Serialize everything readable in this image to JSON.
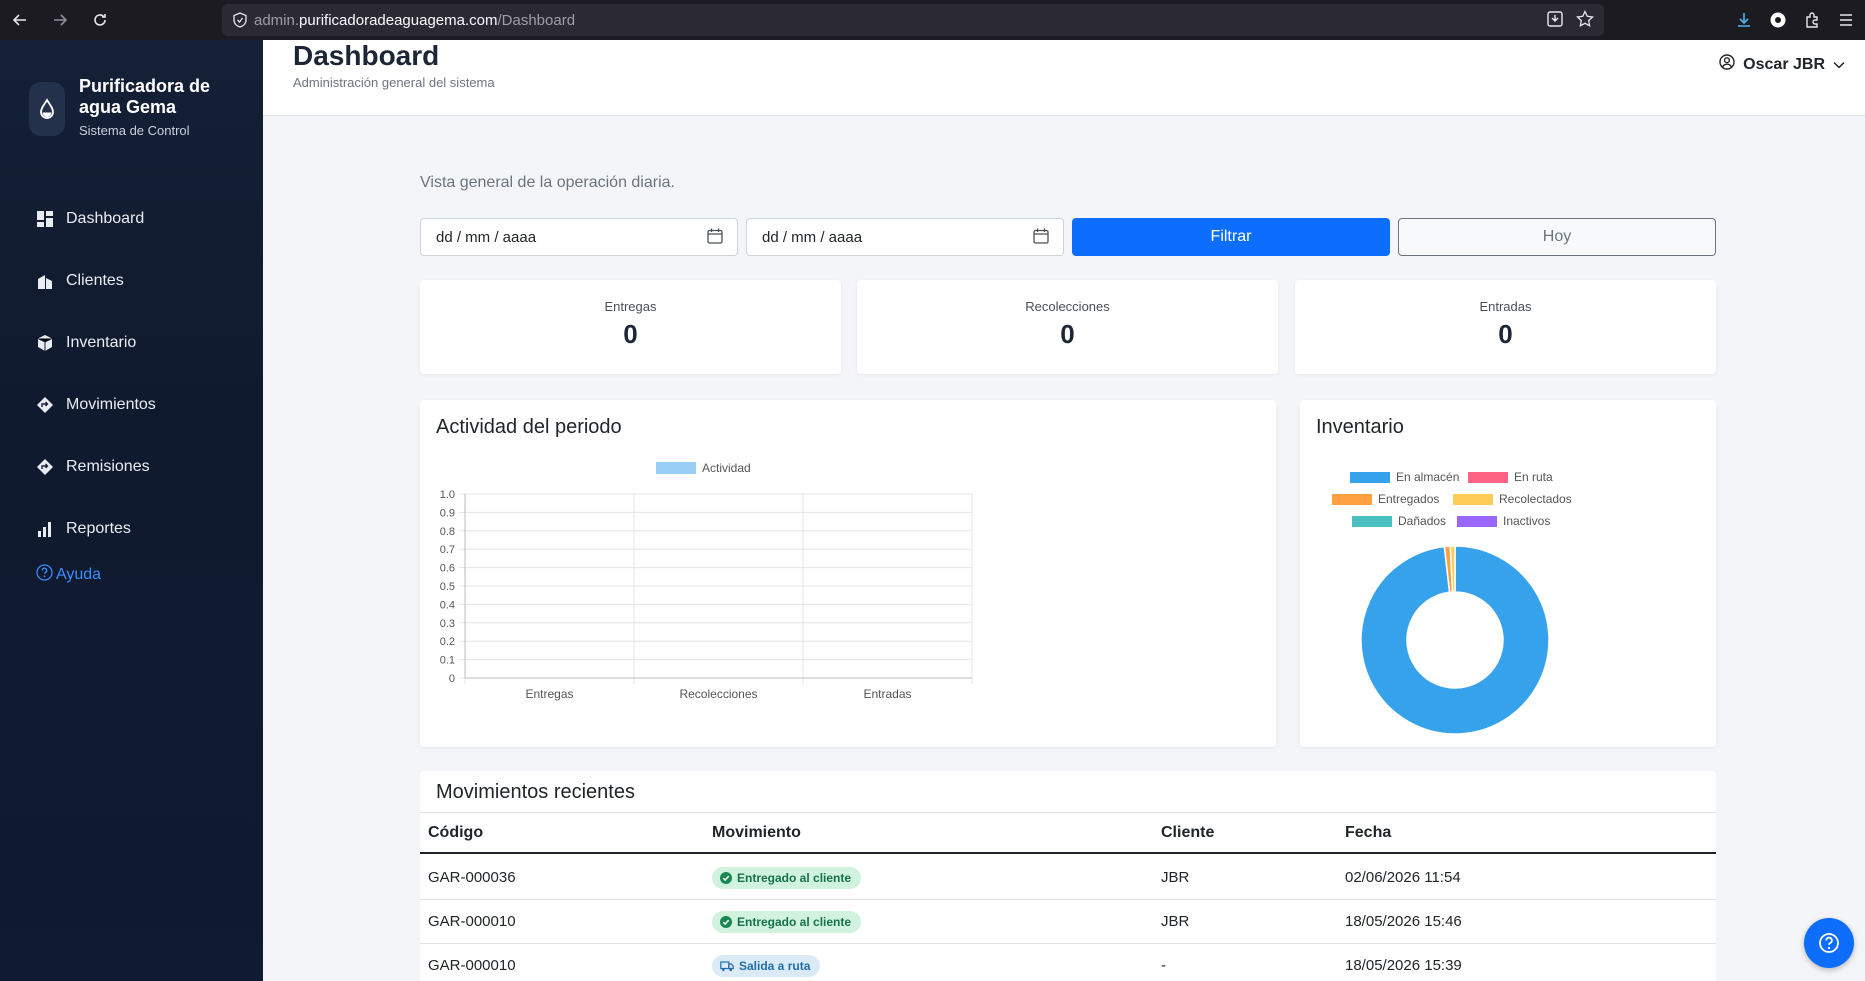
{
  "browser": {
    "url_prefix": "admin.",
    "url_host": "purificadoradeaguagema.com",
    "url_path": "/Dashboard"
  },
  "sidebar": {
    "brand_name": "Purificadora de agua Gema",
    "brand_sub": "Sistema de Control",
    "items": [
      {
        "label": "Dashboard",
        "icon": "dashboard-icon"
      },
      {
        "label": "Clientes",
        "icon": "building-icon"
      },
      {
        "label": "Inventario",
        "icon": "box-icon"
      },
      {
        "label": "Movimientos",
        "icon": "diamond-arrow-icon"
      },
      {
        "label": "Remisiones",
        "icon": "diamond-arrow-icon"
      },
      {
        "label": "Reportes",
        "icon": "bar-chart-icon"
      }
    ],
    "help_label": "Ayuda"
  },
  "header": {
    "title": "Dashboard",
    "subtitle": "Administración general del sistema",
    "user": "Oscar JBR"
  },
  "main": {
    "intro": "Vista general de la operación diaria.",
    "date_from_placeholder": "dd / mm / aaaa",
    "date_to_placeholder": "dd / mm / aaaa",
    "filter_label": "Filtrar",
    "today_label": "Hoy",
    "stats": [
      {
        "label": "Entregas",
        "value": "0"
      },
      {
        "label": "Recolecciones",
        "value": "0"
      },
      {
        "label": "Entradas",
        "value": "0"
      }
    ],
    "activity_title": "Actividad del periodo",
    "inventory_title": "Inventario",
    "recent_title": "Movimientos recientes"
  },
  "chart_data": [
    {
      "type": "bar",
      "categories": [
        "Entregas",
        "Recolecciones",
        "Entradas"
      ],
      "series": [
        {
          "name": "Actividad",
          "values": [
            0,
            0,
            0
          ],
          "color": "#9ad0f5"
        }
      ],
      "ylim": [
        0,
        1.0
      ],
      "yticks": [
        "1.0",
        "0.9",
        "0.8",
        "0.7",
        "0.6",
        "0.5",
        "0.4",
        "0.3",
        "0.2",
        "0.1",
        "0"
      ],
      "legend": "top",
      "grid": true
    },
    {
      "type": "pie",
      "donut": true,
      "labels": [
        "En almacén",
        "En ruta",
        "Entregados",
        "Recolectados",
        "Dañados",
        "Inactivos"
      ],
      "colors": [
        "#36a2eb",
        "#ff6384",
        "#ff9f40",
        "#ffcd56",
        "#4bc0c0",
        "#9966ff"
      ],
      "values": [
        98.2,
        0,
        1.0,
        0.8,
        0,
        0
      ],
      "legend": "top"
    }
  ],
  "table": {
    "columns": [
      "Código",
      "Movimiento",
      "Cliente",
      "Fecha"
    ],
    "rows": [
      {
        "code": "GAR-000036",
        "movement": "Entregado al cliente",
        "kind": "green",
        "client": "JBR",
        "date": "02/06/2026 11:54"
      },
      {
        "code": "GAR-000010",
        "movement": "Entregado al cliente",
        "kind": "green",
        "client": "JBR",
        "date": "18/05/2026 15:46"
      },
      {
        "code": "GAR-000010",
        "movement": "Salida a ruta",
        "kind": "blue",
        "client": "-",
        "date": "18/05/2026 15:39"
      }
    ]
  }
}
